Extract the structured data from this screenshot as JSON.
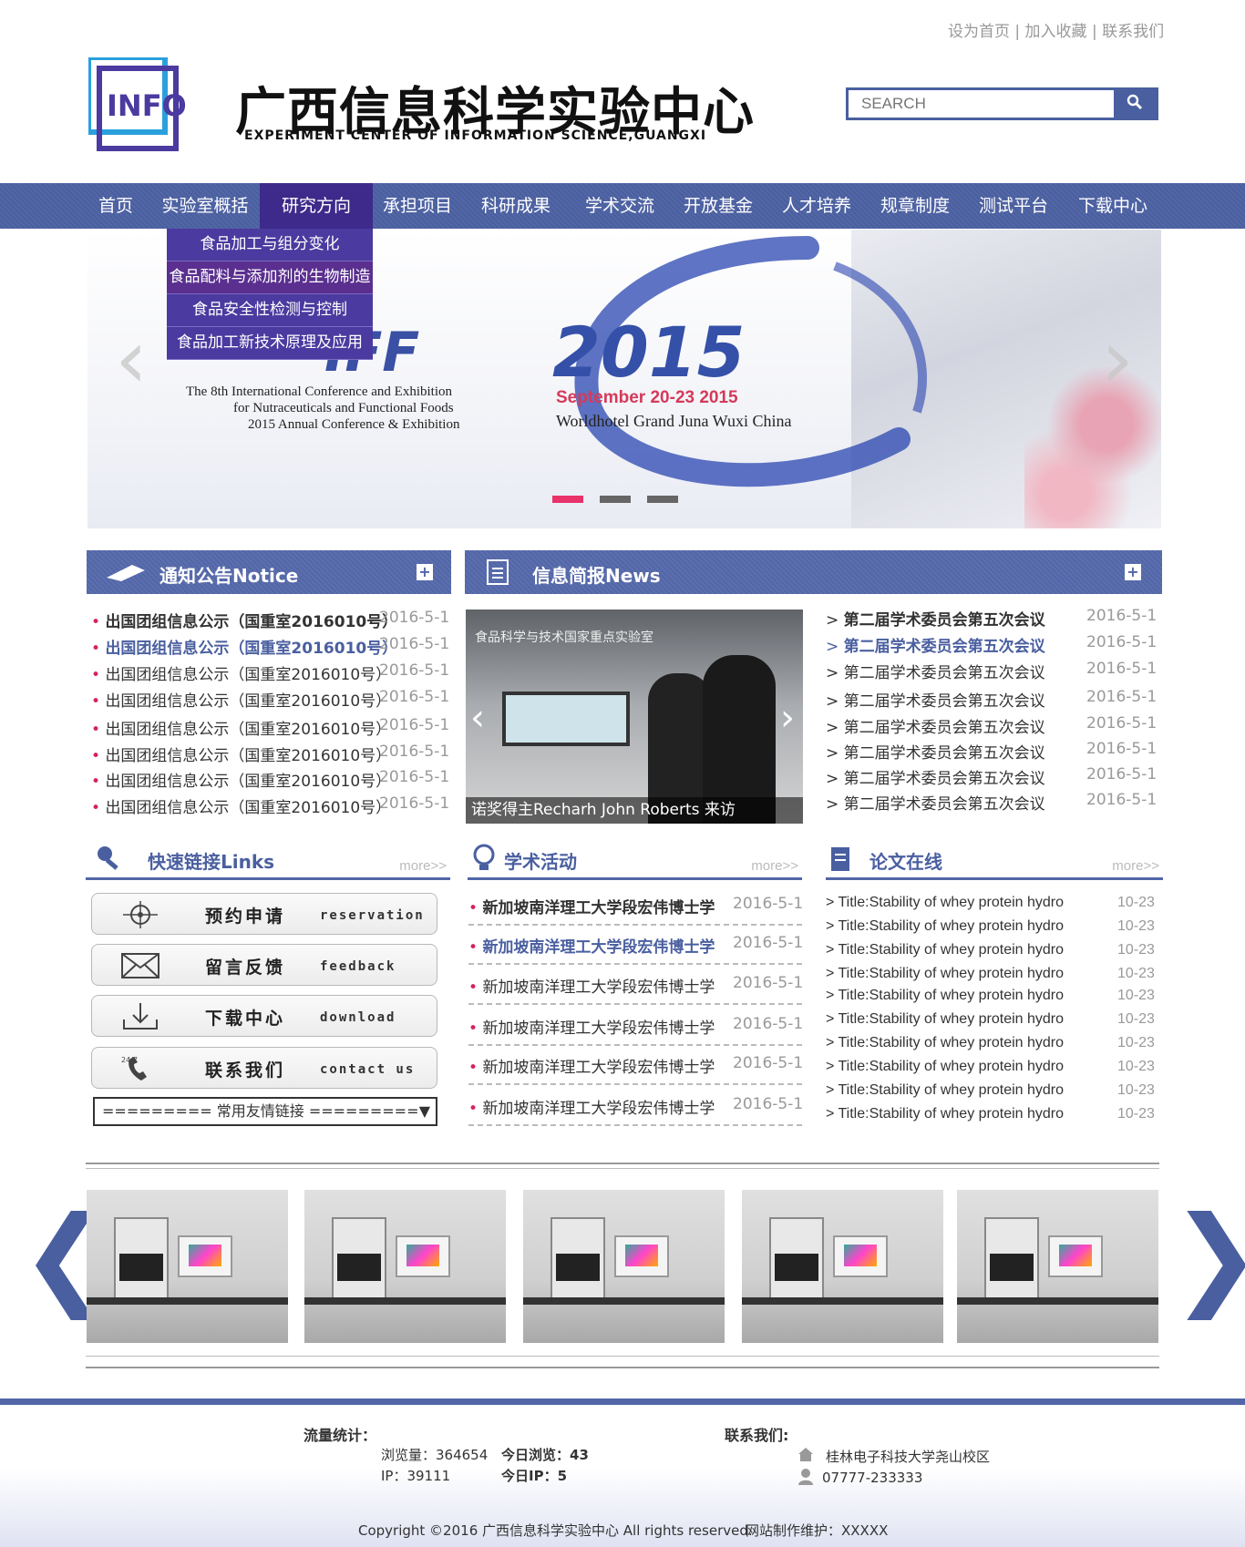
{
  "top_links": {
    "set_home": "设为首页",
    "favorite": "加入收藏",
    "contact": "联系我们",
    "sep": "|"
  },
  "logo": {
    "mark_text": "INFO"
  },
  "site": {
    "title": "广西信息科学实验中心",
    "subtitle": "EXPERIMENT CENTER OF INFORMATION SCIENCE,GUANGXI"
  },
  "search": {
    "placeholder": "SEARCH",
    "icon": "search-icon"
  },
  "nav": [
    {
      "label": "首页"
    },
    {
      "label": "实验室概括"
    },
    {
      "label": "研究方向"
    },
    {
      "label": "承担项目"
    },
    {
      "label": "科研成果"
    },
    {
      "label": "学术交流"
    },
    {
      "label": "开放基金"
    },
    {
      "label": "人才培养"
    },
    {
      "label": "规章制度"
    },
    {
      "label": "测试平台"
    },
    {
      "label": "下载中心"
    }
  ],
  "dropdown": [
    {
      "label": "食品加工与组分变化"
    },
    {
      "label": "食品配料与添加剂的生物制造"
    },
    {
      "label": "食品安全性检测与控制"
    },
    {
      "label": "食品加工新技术原理及应用"
    }
  ],
  "banner": {
    "iff": "IFF",
    "year": "2015",
    "line1": "The 8th International Conference and Exhibition",
    "line2": "for Nutraceuticals and Functional Foods",
    "line3": "2015 Annual Conference & Exhibition",
    "date": "September 20-23 2015",
    "venue": "Worldhotel Grand Juna Wuxi China",
    "arrow_left": "‹",
    "arrow_right": "›",
    "dots_active_color": "#e8326a"
  },
  "notice": {
    "title": "通知公告Notice",
    "items": [
      {
        "text": "出国团组信息公示（国重室2016010号）",
        "date": "2016-5-1"
      },
      {
        "text": "出国团组信息公示（国重室2016010号）",
        "date": "2016-5-1"
      },
      {
        "text": "出国团组信息公示（国重室2016010号）",
        "date": "2016-5-1"
      },
      {
        "text": "出国团组信息公示（国重室2016010号）",
        "date": "2016-5-1"
      },
      {
        "text": "出国团组信息公示（国重室2016010号）",
        "date": "2016-5-1"
      },
      {
        "text": "出国团组信息公示（国重室2016010号）",
        "date": "2016-5-1"
      },
      {
        "text": "出国团组信息公示（国重室2016010号）",
        "date": "2016-5-1"
      },
      {
        "text": "出国团组信息公示（国重室2016010号）",
        "date": "2016-5-1"
      }
    ]
  },
  "news": {
    "title": "信息简报News",
    "photo_caption": "诺奖得主Recharh John Roberts 来访",
    "photo_sign": "食品科学与技术国家重点实验室",
    "items": [
      {
        "text": "第二届学术委员会第五次会议",
        "date": "2016-5-1"
      },
      {
        "text": "第二届学术委员会第五次会议",
        "date": "2016-5-1"
      },
      {
        "text": "第二届学术委员会第五次会议",
        "date": "2016-5-1"
      },
      {
        "text": "第二届学术委员会第五次会议",
        "date": "2016-5-1"
      },
      {
        "text": "第二届学术委员会第五次会议",
        "date": "2016-5-1"
      },
      {
        "text": "第二届学术委员会第五次会议",
        "date": "2016-5-1"
      },
      {
        "text": "第二届学术委员会第五次会议",
        "date": "2016-5-1"
      },
      {
        "text": "第二届学术委员会第五次会议",
        "date": "2016-5-1"
      }
    ]
  },
  "links": {
    "title": "快速链接Links",
    "more": "more>>",
    "buttons": [
      {
        "cn": "预约申请",
        "en": "reservation",
        "icon": "crosshair-icon"
      },
      {
        "cn": "留言反馈",
        "en": "feedback",
        "icon": "envelope-icon"
      },
      {
        "cn": "下载中心",
        "en": "download",
        "icon": "download-icon"
      },
      {
        "cn": "联系我们",
        "en": "contact us",
        "icon": "phone-icon"
      }
    ],
    "friend_select": "========= 常用友情链接 =========",
    "friend_caret": "▼"
  },
  "academic": {
    "title": "学术活动",
    "more": "more>>",
    "items": [
      {
        "text": "新加坡南洋理工大学段宏伟博士学",
        "date": "2016-5-1"
      },
      {
        "text": "新加坡南洋理工大学段宏伟博士学",
        "date": "2016-5-1"
      },
      {
        "text": "新加坡南洋理工大学段宏伟博士学",
        "date": "2016-5-1"
      },
      {
        "text": "新加坡南洋理工大学段宏伟博士学",
        "date": "2016-5-1"
      },
      {
        "text": "新加坡南洋理工大学段宏伟博士学",
        "date": "2016-5-1"
      },
      {
        "text": "新加坡南洋理工大学段宏伟博士学",
        "date": "2016-5-1"
      }
    ]
  },
  "papers": {
    "title": "论文在线",
    "more": "more>>",
    "items": [
      {
        "text": "Title:Stability of whey protein hydro",
        "date": "10-23"
      },
      {
        "text": "Title:Stability of whey protein hydro",
        "date": "10-23"
      },
      {
        "text": "Title:Stability of whey protein hydro",
        "date": "10-23"
      },
      {
        "text": "Title:Stability of whey protein hydro",
        "date": "10-23"
      },
      {
        "text": "Title:Stability of whey protein hydro",
        "date": "10-23"
      },
      {
        "text": "Title:Stability of whey protein hydro",
        "date": "10-23"
      },
      {
        "text": "Title:Stability of whey protein hydro",
        "date": "10-23"
      },
      {
        "text": "Title:Stability of whey protein hydro",
        "date": "10-23"
      },
      {
        "text": "Title:Stability of whey protein hydro",
        "date": "10-23"
      },
      {
        "text": "Title:Stability of whey protein hydro",
        "date": "10-23"
      }
    ]
  },
  "gallery": {
    "arrow_left": "❮",
    "arrow_right": "❯",
    "count": 5
  },
  "footer": {
    "stats_title": "流量统计：",
    "views_label": "浏览量：364654",
    "today_label": "今日浏览：43",
    "ip_label": "IP：39111",
    "today_ip_label": "今日IP：5",
    "contact_title": "联系我们:",
    "address": "桂林电子科技大学尧山校区",
    "phone": "07777-233333",
    "copyright": "Copyright ©2016 广西信息科学实验中心 All rights reserved.",
    "maker": "网站制作维护：XXXXX"
  },
  "colors": {
    "brand": "#4a5fa0",
    "accent": "#d4235a",
    "dropdown": "#4b3a9f"
  }
}
